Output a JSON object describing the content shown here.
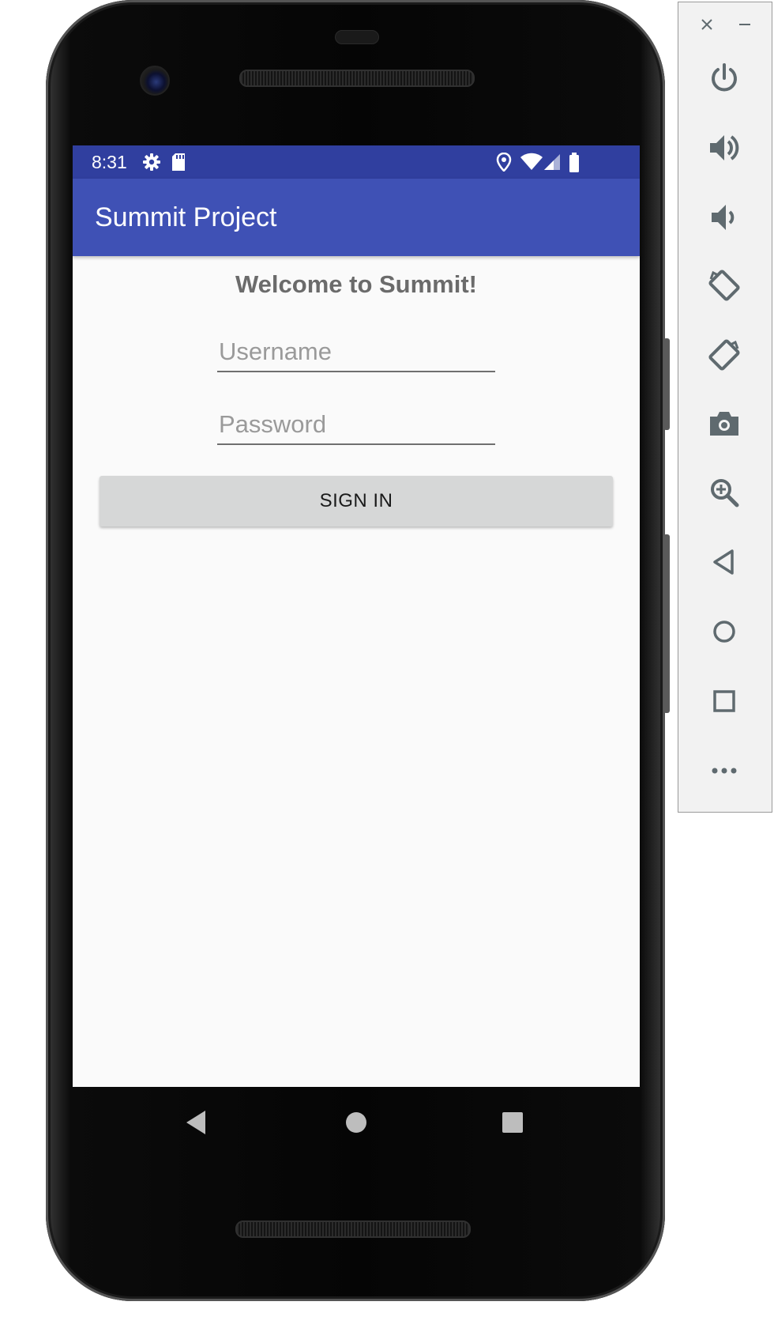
{
  "status_bar": {
    "time": "8:31",
    "left_icons": [
      "gear-icon",
      "sd-card-icon"
    ],
    "right_icons": [
      "location-icon",
      "wifi-icon",
      "signal-icon",
      "battery-icon"
    ]
  },
  "app_bar": {
    "title": "Summit Project"
  },
  "login": {
    "welcome": "Welcome to Summit!",
    "username_placeholder": "Username",
    "password_placeholder": "Password",
    "sign_in_label": "SIGN IN"
  },
  "nav_bar": [
    "back-icon",
    "home-icon",
    "recents-icon"
  ],
  "emulator_toolbar": {
    "window_controls": [
      "close-icon",
      "minimize-icon"
    ],
    "buttons": [
      "power",
      "volume-up",
      "volume-down",
      "rotate-left",
      "rotate-right",
      "screenshot",
      "zoom",
      "back",
      "home",
      "overview",
      "more"
    ]
  },
  "colors": {
    "status_bar": "#303f9f",
    "app_bar": "#3f51b5",
    "screen_bg": "#fafafa",
    "button_bg": "#d6d7d7"
  }
}
